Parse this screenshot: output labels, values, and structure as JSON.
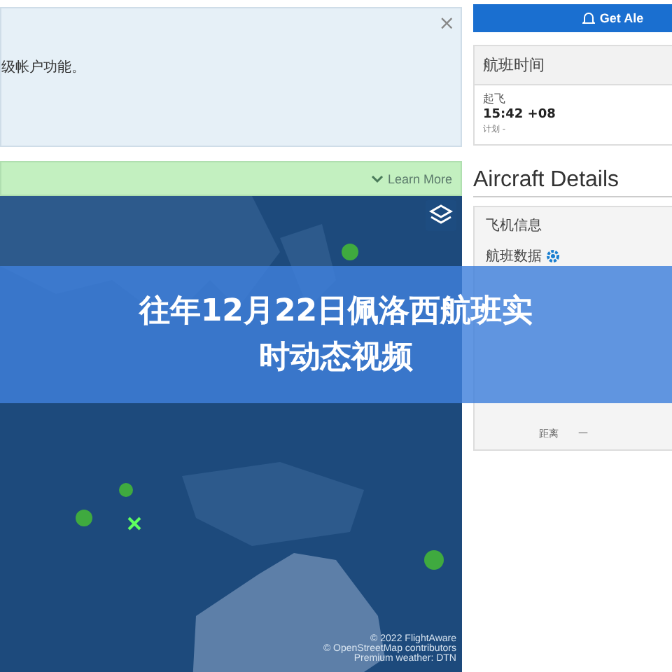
{
  "notice": {
    "text": "级帐户功能。",
    "close": "×"
  },
  "learn_more": {
    "label": "Learn More"
  },
  "map": {
    "attribution": [
      "© 2022 FlightAware",
      "© OpenStreetMap contributors",
      "Premium weather: DTN"
    ]
  },
  "alert_button": {
    "label": "Get Ale"
  },
  "flight_times": {
    "title": "航班时间",
    "label": "起飞",
    "time": "15:42 +08",
    "scheduled": "计划 -"
  },
  "aircraft": {
    "heading": "Aircraft Details",
    "info": "飞机信息",
    "flight_data": "航班数据",
    "rows": [
      {
        "label": "距离",
        "value": "—"
      }
    ]
  },
  "banner": {
    "title": "往年12月22日佩洛西航班实时动态视频"
  }
}
